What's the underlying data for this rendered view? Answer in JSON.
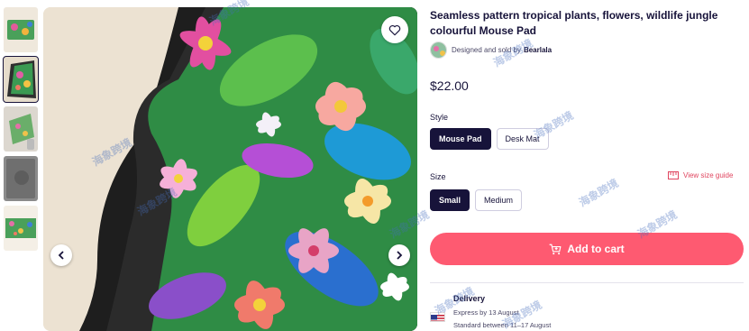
{
  "product": {
    "title": "Seamless pattern tropical plants, flowers, wildlife jungle colourful Mouse Pad",
    "designer_prefix": "Designed and sold by",
    "designer_name": "Bearlala",
    "price": "$22.00"
  },
  "style": {
    "label": "Style",
    "options": [
      "Mouse Pad",
      "Desk Mat"
    ],
    "selected": "Mouse Pad"
  },
  "size": {
    "label": "Size",
    "options": [
      "Small",
      "Medium"
    ],
    "selected": "Small",
    "guide_label": "View size guide"
  },
  "cart": {
    "label": "Add to cart"
  },
  "delivery": {
    "title": "Delivery",
    "express": "Express by 13 August",
    "standard": "Standard between 11–17 August"
  },
  "watermark": "海象跨境",
  "icons": {
    "favorite": "heart-outline-icon",
    "prev": "chevron-left-icon",
    "next": "chevron-right-icon",
    "cart": "cart-icon",
    "size_guide": "ruler-icon",
    "flag": "us-flag-icon"
  },
  "colors": {
    "brand_dark": "#17133a",
    "cta": "#fe5a71",
    "link": "#e0455f"
  }
}
